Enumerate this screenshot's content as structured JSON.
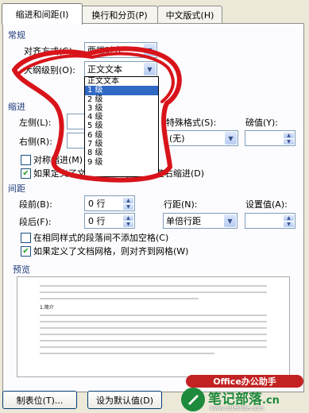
{
  "tabs": [
    "缩进和间距(I)",
    "换行和分页(P)",
    "中文版式(H)"
  ],
  "general": {
    "title": "常规",
    "alignment_label": "对齐方式(G):",
    "alignment_value": "两端对齐",
    "outline_label": "大纲级别(O):",
    "outline_value": "正文文本",
    "outline_options": [
      "正文文本",
      "1 级",
      "2 级",
      "3 级",
      "4 级",
      "5 级",
      "6 级",
      "7 级",
      "8 级",
      "9 级"
    ],
    "outline_selected_index": 1
  },
  "indent": {
    "title": "缩进",
    "left_label": "左侧(L):",
    "right_label": "右侧(R):",
    "special_label": "特殊格式(S):",
    "special_value": "(无)",
    "measure_label": "磅值(Y):",
    "symmetric_label": "对称缩进(M)",
    "auto_adjust_label": "如果定义了文档网格，则自动调整右缩进(D)"
  },
  "spacing": {
    "title": "间距",
    "before_label": "段前(B):",
    "before_value": "0 行",
    "after_label": "段后(F):",
    "after_value": "0 行",
    "line_label": "行距(N):",
    "line_value": "单倍行距",
    "at_label": "设置值(A):",
    "no_space_label": "在相同样式的段落间不添加空格(C)",
    "snap_grid_label": "如果定义了文档网格，则对齐到网格(W)"
  },
  "preview": {
    "title": "预览",
    "sample_heading": "1.简介"
  },
  "buttons": {
    "tabs": "制表位(T)...",
    "default": "设为默认值(D)"
  },
  "watermark": {
    "brand": "Office办公助手",
    "site": "笔记部落",
    "domain": ".cn",
    "url": "www.notetribe.com"
  },
  "colors": {
    "highlight": "#316ac5",
    "annotation": "#d8141a",
    "brand": "#1e8a3c"
  }
}
